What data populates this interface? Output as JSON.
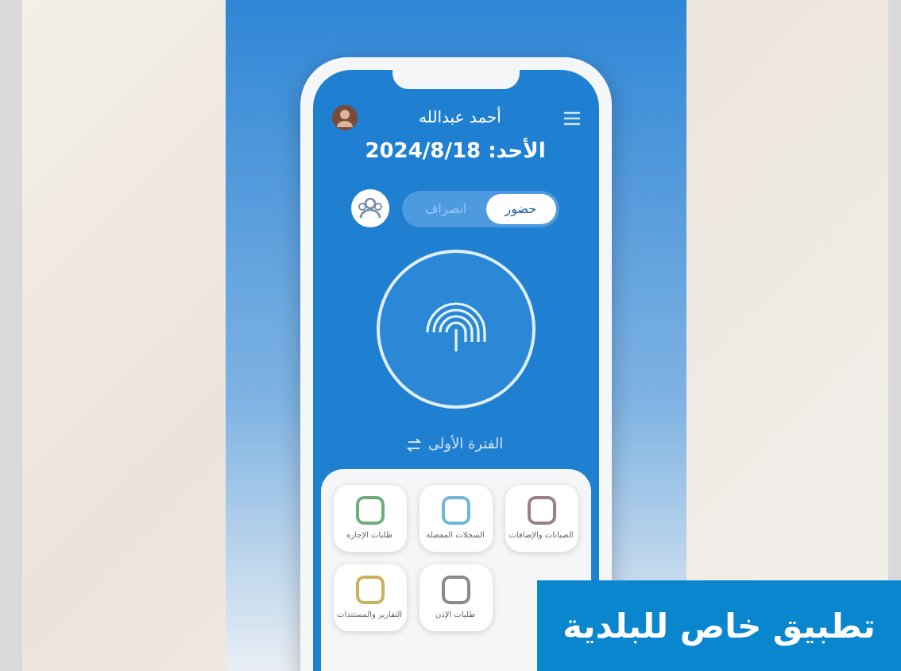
{
  "app": {
    "user_name": "أحمد عبدالله",
    "date_label": "الأحد: 2024/8/18",
    "attendance_toggle": [
      {
        "label": "حضور",
        "selected": true
      },
      {
        "label": "انصراف",
        "selected": false
      }
    ],
    "shift": "الفترة الأولى",
    "tiles": [
      {
        "label": "الصيانات والإضافات",
        "color": "#9a7f8c"
      },
      {
        "label": "السجلات المفصلة",
        "color": "#6fb7d6"
      },
      {
        "label": "طلبات الإجازة",
        "color": "#6fae7a"
      },
      {
        "label": "طلبات الإذن",
        "color": "#8a8a8a"
      },
      {
        "label": "التقارير والمستندات",
        "color": "#c9b25a"
      }
    ]
  },
  "caption": "تطبيق خاص للبلدية"
}
